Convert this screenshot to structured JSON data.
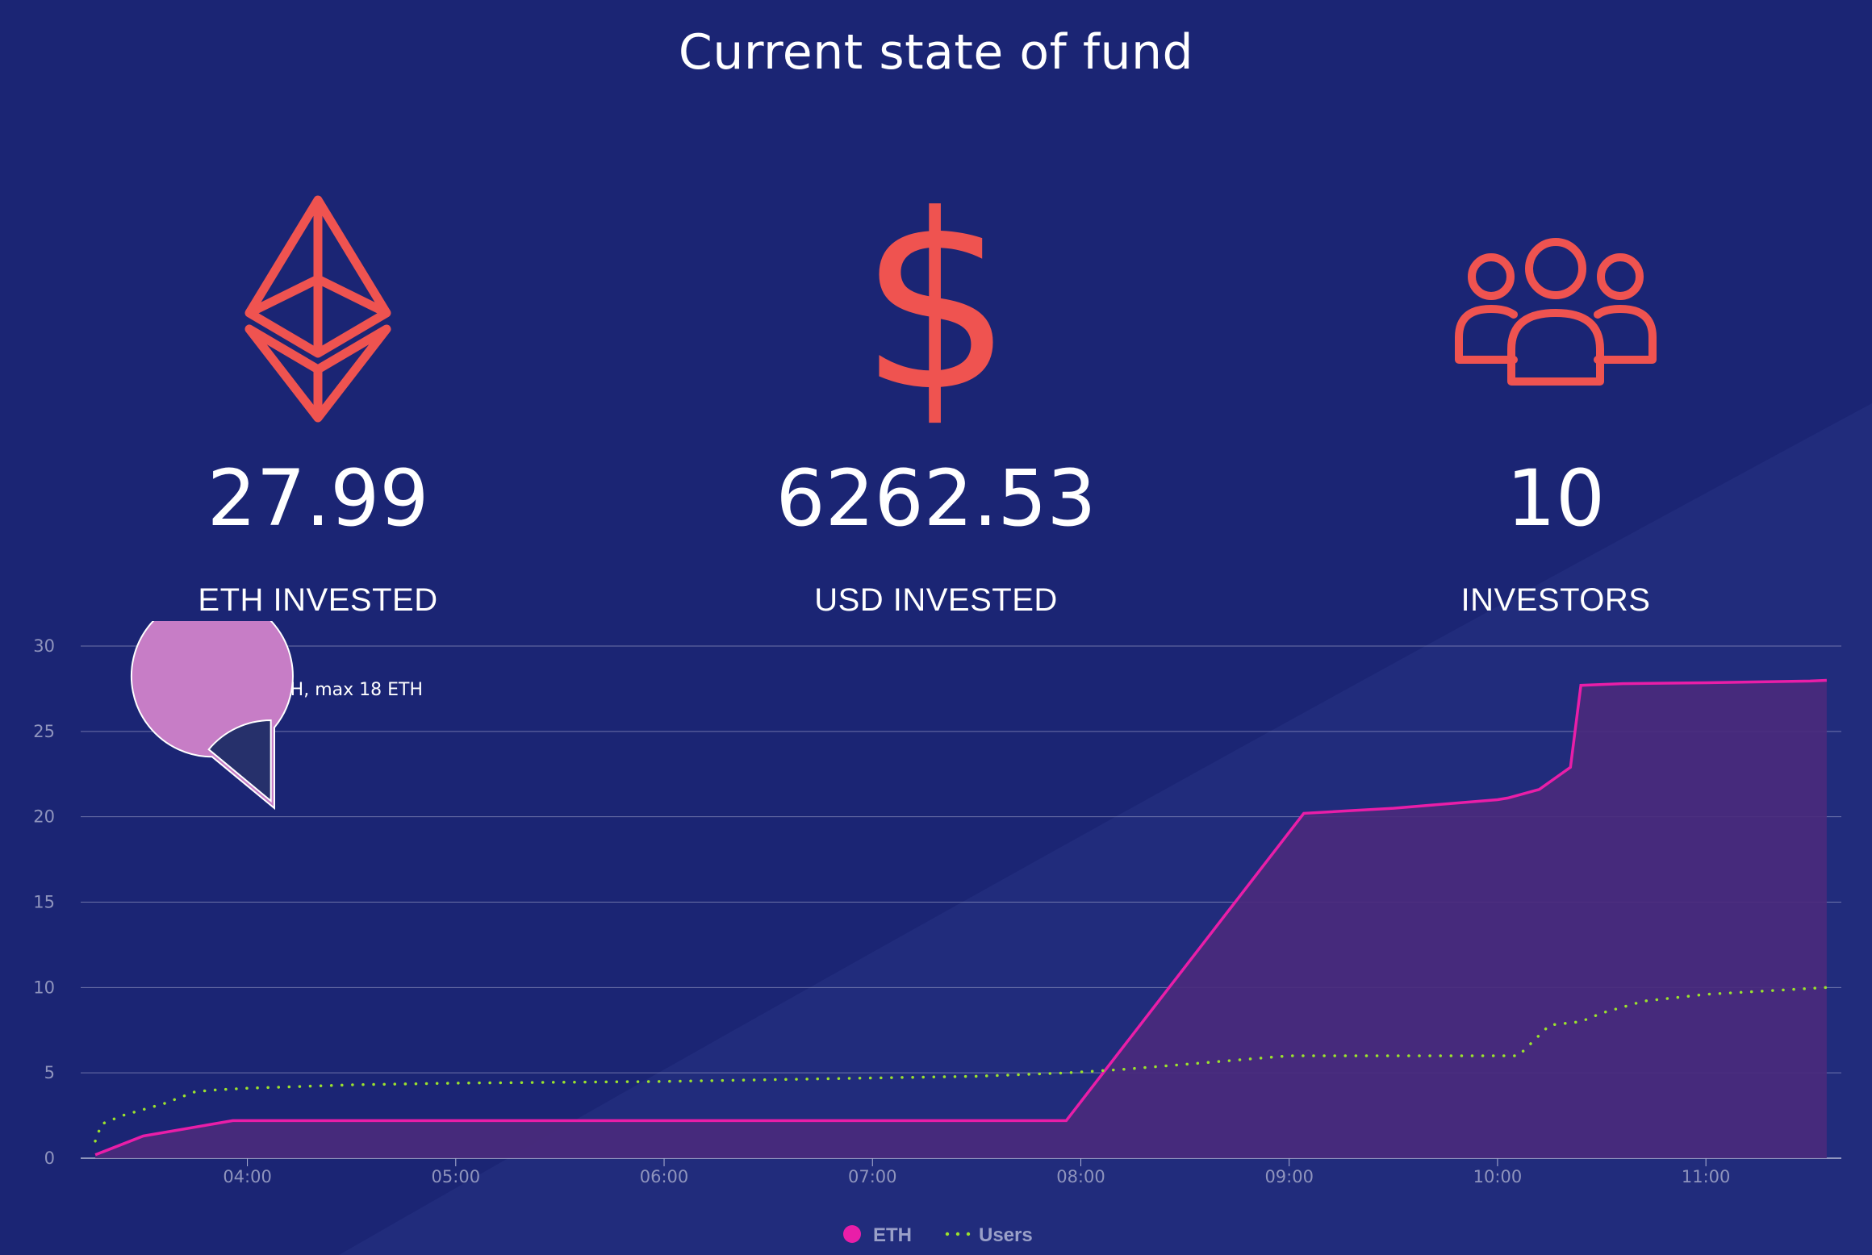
{
  "header": {
    "title": "Current state of fund"
  },
  "stats": [
    {
      "icon": "ethereum-icon",
      "value": "27.99",
      "label": "ETH INVESTED"
    },
    {
      "icon": "dollar-icon",
      "value": "6262.53",
      "label": "USD INVESTED"
    },
    {
      "icon": "users-icon",
      "value": "10",
      "label": "INVESTORS"
    }
  ],
  "colors": {
    "background": "#1b2574",
    "accent": "#ef5350",
    "eth_line": "#e91ea8",
    "eth_fill": "#4a2a7c",
    "users_line": "#9be22d",
    "pie_main": "#c77dc6",
    "pie_slice": "#26306b"
  },
  "chart_data": {
    "type": "area",
    "x_unit": "hours",
    "x_ticks": [
      "04:00",
      "05:00",
      "06:00",
      "07:00",
      "08:00",
      "09:00",
      "10:00",
      "11:00"
    ],
    "x_tick_values": [
      4,
      5,
      6,
      7,
      8,
      9,
      10,
      11
    ],
    "xlim": [
      3.2,
      11.65
    ],
    "ylim": [
      0,
      30
    ],
    "y_ticks": [
      0,
      5,
      10,
      15,
      20,
      25,
      30
    ],
    "grid": true,
    "legend_position": "bottom-center",
    "series": [
      {
        "name": "ETH",
        "style": "area-line",
        "x": [
          3.27,
          3.5,
          3.93,
          4.2,
          5.0,
          6.0,
          7.0,
          7.93,
          9.07,
          9.5,
          10.0,
          10.05,
          10.2,
          10.35,
          10.4,
          10.6,
          11.0,
          11.5,
          11.58
        ],
        "y": [
          0.2,
          1.3,
          2.2,
          2.2,
          2.2,
          2.2,
          2.2,
          2.2,
          20.2,
          20.5,
          21.0,
          21.1,
          21.6,
          22.9,
          27.7,
          27.8,
          27.85,
          27.95,
          27.99
        ]
      },
      {
        "name": "Users",
        "style": "dotted-line",
        "x": [
          3.27,
          3.3,
          3.4,
          3.6,
          3.75,
          3.85,
          4.0,
          4.5,
          5.0,
          6.0,
          7.0,
          7.5,
          7.93,
          8.2,
          8.5,
          8.8,
          9.0,
          9.5,
          10.0,
          10.1,
          10.25,
          10.4,
          10.5,
          10.7,
          11.0,
          11.58
        ],
        "y": [
          1.0,
          2.0,
          2.5,
          3.2,
          3.9,
          4.0,
          4.1,
          4.3,
          4.4,
          4.5,
          4.7,
          4.8,
          5.0,
          5.2,
          5.5,
          5.8,
          6.0,
          6.0,
          6.0,
          6.0,
          7.8,
          8.0,
          8.5,
          9.2,
          9.6,
          10.0
        ]
      }
    ],
    "inset_pie": {
      "title": "Average 2.8ETH, max 18 ETH",
      "values": [
        86,
        14
      ]
    }
  }
}
